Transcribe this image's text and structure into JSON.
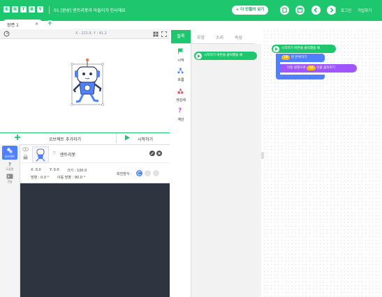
{
  "header": {
    "logo": "ENTRY",
    "logo_letters": [
      "E",
      "N",
      "T",
      "R",
      "Y"
    ],
    "project_title": "01 [완성] 엔트리봇과 아들이가 인사해요",
    "make_button": "+ 더 만들어 보기",
    "login": "로그인",
    "signup": "가입하기",
    "brand_color": "#1ec76e"
  },
  "scene": {
    "tab_label": "장면 1",
    "close": "×",
    "add": "+"
  },
  "stage": {
    "coords": "X : 222.9, Y : 41.2"
  },
  "object_bar": {
    "add_object": "오브젝트 추가하기",
    "run": "시작하기"
  },
  "side": {
    "object_tab": "오브젝트",
    "help_tab": "도움말",
    "console_tab": "콘솔"
  },
  "object": {
    "name": "엔트리봇",
    "x": "X: 0.0",
    "y": "Y: 0.0",
    "size": "크기 : 100.0",
    "direction": "방향 : 0.0 °",
    "move_direction": "이동 방향 : 90.0 °",
    "rotation_label": "회전방식 :"
  },
  "categories": {
    "tabs": [
      "블록",
      "모양",
      "소리",
      "속성"
    ],
    "items": [
      "시작",
      "흐름",
      "생김새",
      "계산"
    ]
  },
  "palette": {
    "start_block": "시작하기 버튼을 클릭했을 때"
  },
  "workspace": {
    "when_run": "시작하기 버튼을 클릭했을 때",
    "repeat_count": "10",
    "repeat_label": "번 반복하기",
    "move_prefix": "이동 방향으로",
    "move_value": "10",
    "move_suffix": "만큼 움직이기"
  }
}
